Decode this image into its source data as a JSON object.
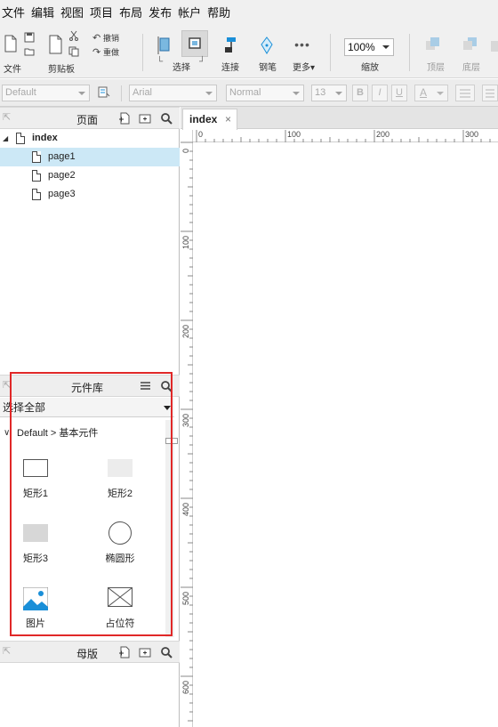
{
  "menu": [
    "文件",
    "编辑",
    "视图",
    "项目",
    "布局",
    "发布",
    "帐户",
    "帮助"
  ],
  "toolbar": {
    "file_label": "文件",
    "clipboard_label": "剪贴板",
    "undo_label": "撤销",
    "redo_label": "重做",
    "select_label": "选择",
    "connect_label": "连接",
    "pen_label": "钢笔",
    "more_label": "更多▾",
    "zoom_value": "100%",
    "zoom_label": "缩放",
    "top_label": "顶层",
    "bottom_label": "底层"
  },
  "format": {
    "style_value": "Default",
    "font_value": "Arial",
    "weight_value": "Normal",
    "size_value": "13",
    "bold": "B",
    "italic": "I",
    "underline": "U",
    "font_color": "A"
  },
  "pages_panel": {
    "title": "页面",
    "root": "index",
    "children": [
      "page1",
      "page2",
      "page3"
    ],
    "selected": "page1"
  },
  "library_panel": {
    "title": "元件库",
    "filter": "选择全部",
    "group": "Default > 基本元件",
    "widgets": [
      {
        "name": "矩形1",
        "icon": "rectangle-icon"
      },
      {
        "name": "矩形2",
        "icon": "rectangle-filled-light-icon"
      },
      {
        "name": "矩形3",
        "icon": "rectangle-filled-gray-icon"
      },
      {
        "name": "椭圆形",
        "icon": "ellipse-icon"
      },
      {
        "name": "图片",
        "icon": "image-icon"
      },
      {
        "name": "占位符",
        "icon": "placeholder-icon"
      }
    ]
  },
  "masters_panel": {
    "title": "母版"
  },
  "canvas": {
    "tab": "index",
    "tab_close": "×",
    "h_ruler": [
      "0",
      "100",
      "200",
      "300"
    ],
    "v_ruler": [
      "0",
      "100",
      "200",
      "300",
      "400",
      "500",
      "600"
    ]
  },
  "colors": {
    "selection": "#cce8f6",
    "highlight_border": "#e02828",
    "accent_blue": "#1a8fd8"
  }
}
